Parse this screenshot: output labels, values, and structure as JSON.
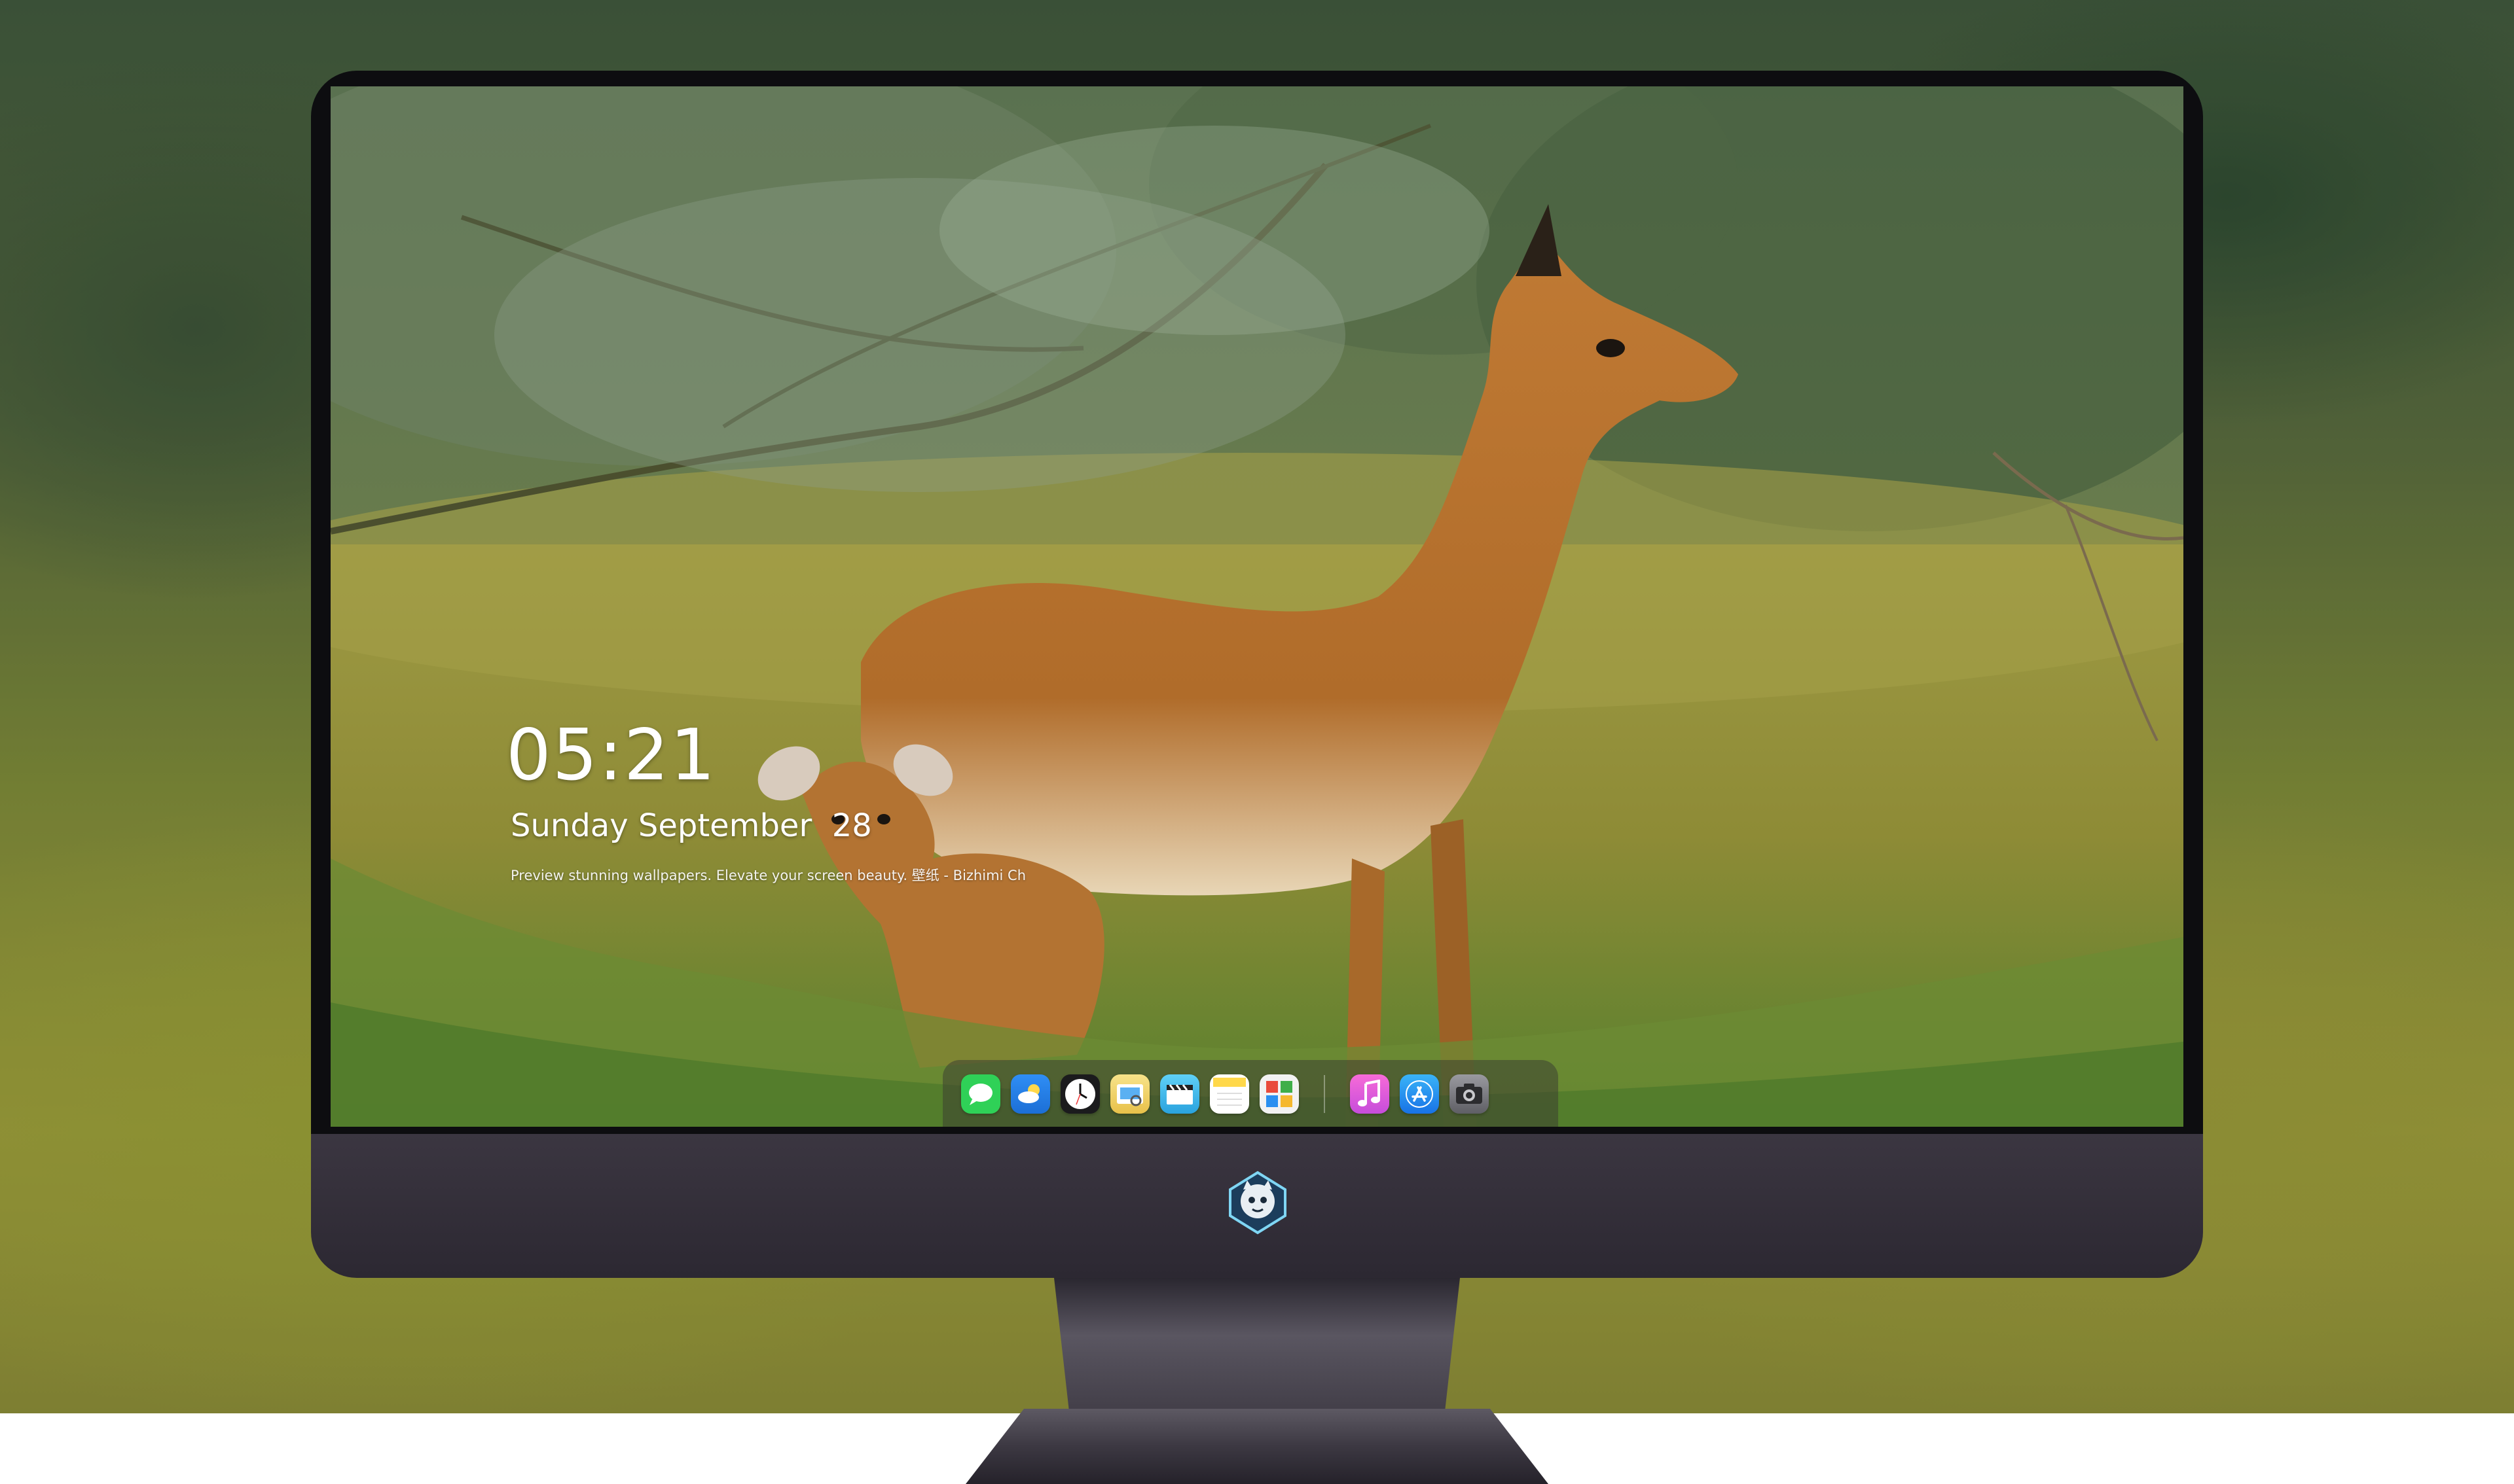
{
  "lockscreen": {
    "time": "05:21",
    "date": "Sunday September  28",
    "tagline": "Preview stunning wallpapers. Elevate your screen beauty. 壁纸 - Bizhimi Ch"
  },
  "dock": {
    "apps": [
      {
        "name": "Messages",
        "icon": "messages-icon",
        "color": "#2fd157"
      },
      {
        "name": "Weather",
        "icon": "weather-icon",
        "color": "#2a8ff0"
      },
      {
        "name": "Clock",
        "icon": "clock-icon",
        "color": "#ffffff"
      },
      {
        "name": "Preview",
        "icon": "preview-icon",
        "color": "#f3d45a"
      },
      {
        "name": "Clips",
        "icon": "clapperboard-icon",
        "color": "#4cc2f0"
      },
      {
        "name": "Notes",
        "icon": "notes-icon",
        "color": "#ffd84a"
      },
      {
        "name": "Photo Booth",
        "icon": "photo-grid-icon",
        "color": "#e94b3c"
      },
      {
        "name": "Music",
        "icon": "music-icon",
        "color": "#e95ce1"
      },
      {
        "name": "App Store",
        "icon": "app-store-icon",
        "color": "#1f8ef4"
      },
      {
        "name": "Camera",
        "icon": "camera-icon",
        "color": "#7c7c80"
      }
    ]
  },
  "colors": {
    "bezel": "#0d0d10",
    "chin": "#35303b",
    "accent_text": "#ffffff"
  }
}
